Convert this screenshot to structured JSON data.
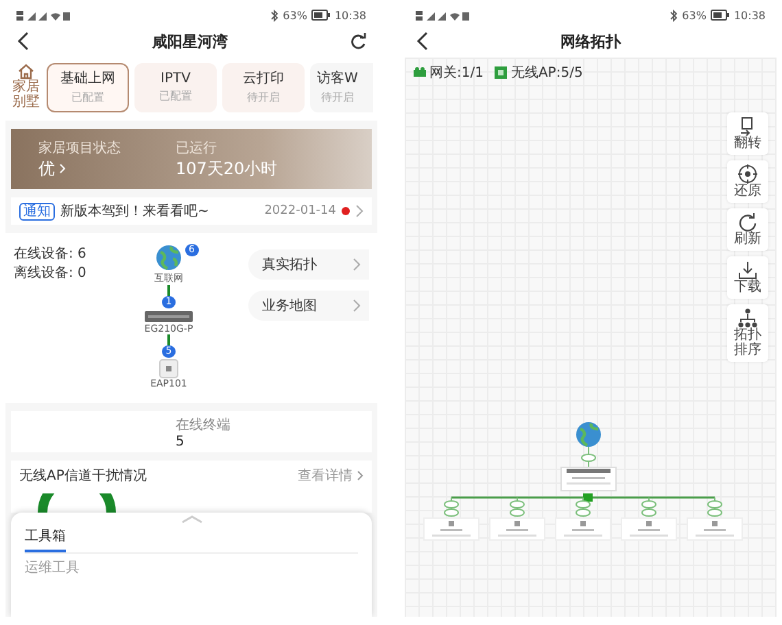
{
  "left_screen": {
    "status_bar": {
      "battery": "63%",
      "time": "10:38"
    },
    "header": {
      "title": "咸阳星河湾"
    },
    "home_tab": {
      "label": "家居别墅"
    },
    "service_tabs": [
      {
        "name": "基础上网",
        "status": "已配置",
        "selected": true
      },
      {
        "name": "IPTV",
        "status": "已配置",
        "selected": false
      },
      {
        "name": "云打印",
        "status": "待开启",
        "selected": false
      },
      {
        "name": "访客W",
        "status": "待开启",
        "selected": false
      }
    ],
    "status_banner": {
      "label": "家居项目状态",
      "value": "优",
      "runtime_label": "已运行",
      "runtime_value": "107天20小时"
    },
    "notice": {
      "tag": "通知",
      "text": "新版本驾到！来看看吧~",
      "date": "2022-01-14",
      "unread": true
    },
    "topology": {
      "online": "在线设备: 6",
      "offline": "离线设备: 0",
      "nodes": [
        {
          "kind": "internet",
          "label": "互联网",
          "count": "6"
        },
        {
          "kind": "gateway",
          "label": "EG210G-P",
          "count": "1"
        },
        {
          "kind": "ap",
          "label": "EAP101",
          "count": "5"
        }
      ],
      "links": [
        "真实拓扑",
        "业务地图"
      ]
    },
    "terminals": {
      "label": "在线终端",
      "value": "5"
    },
    "ap_interference": {
      "title": "无线AP信道干扰情况",
      "link": "查看详情"
    },
    "toolbox": {
      "tabs": [
        {
          "label": "工具箱",
          "selected": true
        }
      ],
      "section": "运维工具"
    }
  },
  "right_screen": {
    "status_bar": {
      "battery": "63%",
      "time": "10:38"
    },
    "header": {
      "title": "网络拓扑"
    },
    "legend": [
      {
        "kind": "gateway",
        "label": "网关:1/1"
      },
      {
        "kind": "ap",
        "label": "无线AP:5/5"
      }
    ],
    "tools": [
      {
        "kind": "flip",
        "label": "翻转"
      },
      {
        "kind": "restore",
        "label": "还原"
      },
      {
        "kind": "refresh",
        "label": "刷新"
      },
      {
        "kind": "download",
        "label": "下载"
      },
      {
        "kind": "sort",
        "label": "拓扑排序"
      }
    ]
  }
}
